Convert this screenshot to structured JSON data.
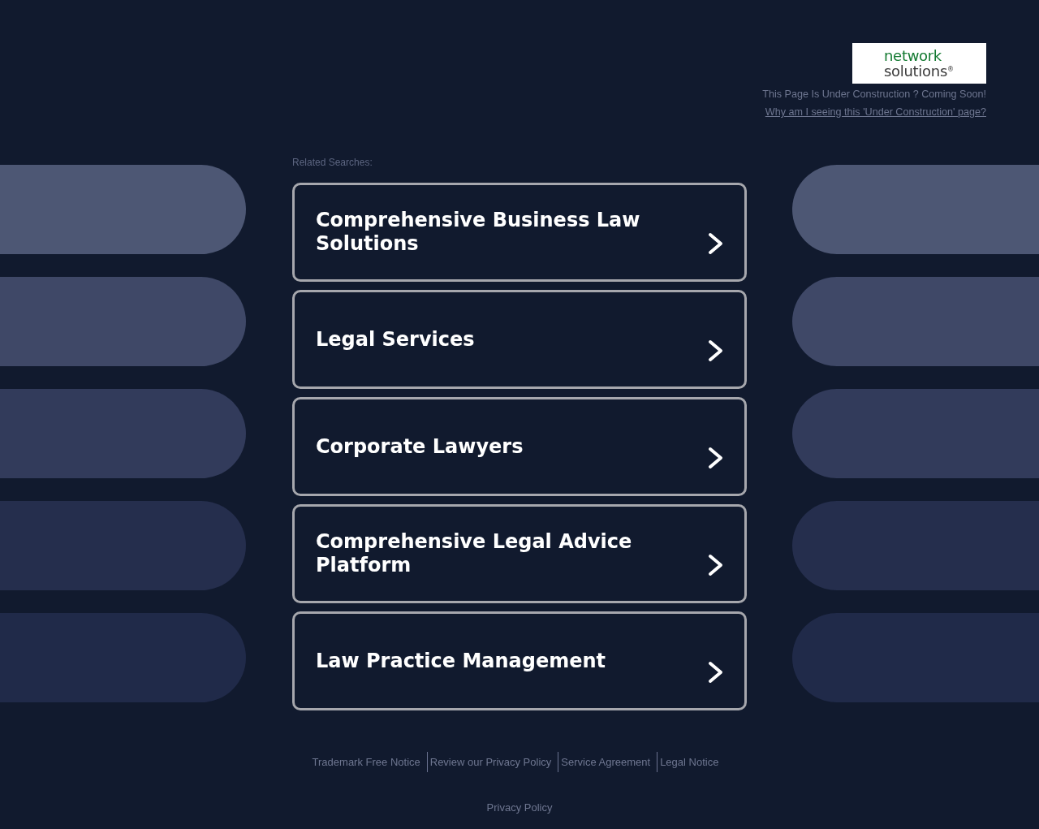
{
  "logo": {
    "line_1": "network",
    "line_2": "solutions$^{®}$"
  },
  "notice": "This Page Is Under Construction ? Coming Soon!",
  "notice_link": "Why am I seeing this 'Under Construction' page?",
  "related_searches": {
    "label": "Related Searches:",
    "items": [
      "Comprehensive Business Law Solutions",
      "Legal Services",
      "Corporate Lawyers",
      "Comprehensive Legal Advice Platform",
      "Law Practice Management"
    ]
  },
  "footer": {
    "links": [
      "Trademark Free Notice",
      "Review our Privacy Policy",
      "Service Agreement",
      "Legal Notice"
    ],
    "privacy_link": "Privacy Policy"
  }
}
